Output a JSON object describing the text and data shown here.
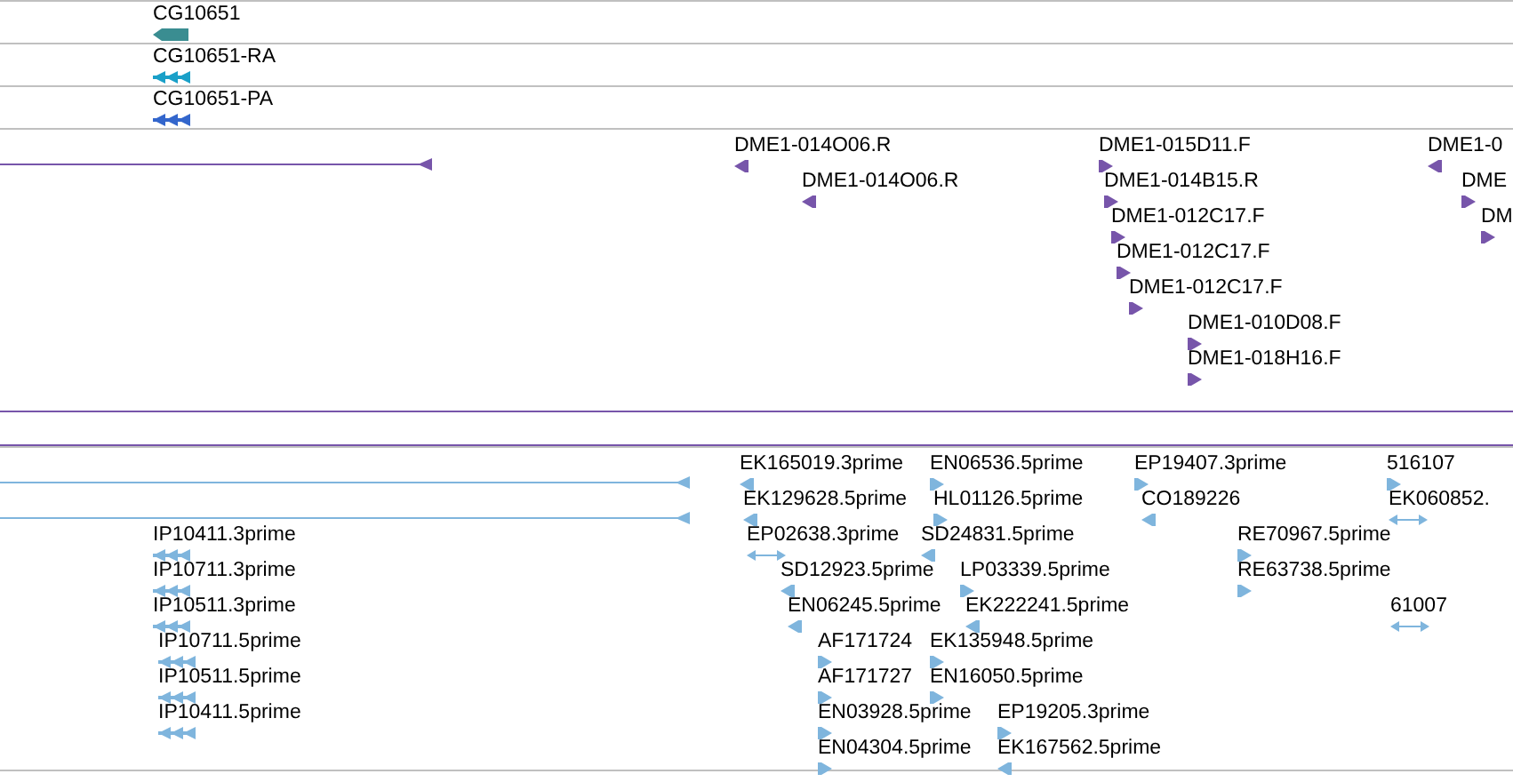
{
  "tracks": [
    {
      "color": "#3a8d91",
      "features": [
        {
          "label": "CG10651",
          "kind": "gene"
        }
      ]
    },
    {
      "color": "#1aa0c8",
      "features": [
        {
          "label": "CG10651-RA",
          "kind": "multi-left"
        }
      ]
    },
    {
      "color": "#3366cc",
      "features": [
        {
          "label": "CG10651-PA",
          "kind": "multi-left"
        }
      ]
    },
    {
      "color": "#7755aa",
      "features": [
        {
          "kind": "line-left"
        },
        {
          "label": "DME1-014O06.R",
          "kind": "left"
        },
        {
          "label": "DME1-015D11.F",
          "kind": "right"
        },
        {
          "label": "DME1-0",
          "kind": "left"
        },
        {
          "label": "DME1-014O06.R",
          "kind": "left"
        },
        {
          "label": "DME1-014B15.R",
          "kind": "right"
        },
        {
          "label": "DME",
          "kind": "right"
        },
        {
          "label": "DME1-012C17.F",
          "kind": "right"
        },
        {
          "label": "DM",
          "kind": "right"
        },
        {
          "label": "DME1-012C17.F",
          "kind": "right"
        },
        {
          "label": "DME1-012C17.F",
          "kind": "right"
        },
        {
          "label": "DME1-010D08.F",
          "kind": "right"
        },
        {
          "label": "DME1-018H16.F",
          "kind": "right"
        }
      ]
    },
    {
      "color": "#7fb5dd",
      "features": [
        {
          "kind": "line-left"
        },
        {
          "kind": "line-left"
        },
        {
          "label": "EK165019.3prime",
          "kind": "left"
        },
        {
          "label": "EN06536.5prime",
          "kind": "right"
        },
        {
          "label": "EP19407.3prime",
          "kind": "right"
        },
        {
          "label": "516107",
          "kind": "right"
        },
        {
          "label": "EK129628.5prime",
          "kind": "left"
        },
        {
          "label": "HL01126.5prime",
          "kind": "right"
        },
        {
          "label": "CO189226",
          "kind": "left"
        },
        {
          "label": "EK060852.",
          "kind": "both"
        },
        {
          "label": "IP10411.3prime",
          "kind": "multi-left"
        },
        {
          "label": "EP02638.3prime",
          "kind": "both"
        },
        {
          "label": "SD24831.5prime",
          "kind": "left"
        },
        {
          "label": "RE70967.5prime",
          "kind": "right"
        },
        {
          "label": "IP10711.3prime",
          "kind": "multi-left"
        },
        {
          "label": "SD12923.5prime",
          "kind": "left"
        },
        {
          "label": "LP03339.5prime",
          "kind": "right"
        },
        {
          "label": "RE63738.5prime",
          "kind": "right"
        },
        {
          "label": "IP10511.3prime",
          "kind": "multi-left"
        },
        {
          "label": "EN06245.5prime",
          "kind": "left"
        },
        {
          "label": "EK222241.5prime",
          "kind": "left"
        },
        {
          "label": "61007",
          "kind": "both"
        },
        {
          "label": "IP10711.5prime",
          "kind": "multi-left"
        },
        {
          "label": "AF171724",
          "kind": "right"
        },
        {
          "label": "EK135948.5prime",
          "kind": "right"
        },
        {
          "label": "IP10511.5prime",
          "kind": "multi-left"
        },
        {
          "label": "AF171727",
          "kind": "right"
        },
        {
          "label": "EN16050.5prime",
          "kind": "right"
        },
        {
          "label": "IP10411.5prime",
          "kind": "multi-left"
        },
        {
          "label": "EN03928.5prime",
          "kind": "right"
        },
        {
          "label": "EP19205.3prime",
          "kind": "right"
        },
        {
          "label": "EN04304.5prime",
          "kind": "right"
        },
        {
          "label": "EK167562.5prime",
          "kind": "left"
        }
      ]
    }
  ]
}
